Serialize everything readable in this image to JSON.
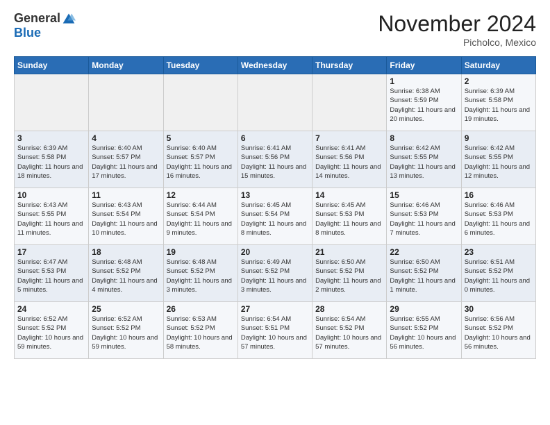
{
  "header": {
    "logo_general": "General",
    "logo_blue": "Blue",
    "month_title": "November 2024",
    "location": "Picholco, Mexico"
  },
  "weekdays": [
    "Sunday",
    "Monday",
    "Tuesday",
    "Wednesday",
    "Thursday",
    "Friday",
    "Saturday"
  ],
  "weeks": [
    [
      {
        "day": "",
        "info": ""
      },
      {
        "day": "",
        "info": ""
      },
      {
        "day": "",
        "info": ""
      },
      {
        "day": "",
        "info": ""
      },
      {
        "day": "",
        "info": ""
      },
      {
        "day": "1",
        "info": "Sunrise: 6:38 AM\nSunset: 5:59 PM\nDaylight: 11 hours and 20 minutes."
      },
      {
        "day": "2",
        "info": "Sunrise: 6:39 AM\nSunset: 5:58 PM\nDaylight: 11 hours and 19 minutes."
      }
    ],
    [
      {
        "day": "3",
        "info": "Sunrise: 6:39 AM\nSunset: 5:58 PM\nDaylight: 11 hours and 18 minutes."
      },
      {
        "day": "4",
        "info": "Sunrise: 6:40 AM\nSunset: 5:57 PM\nDaylight: 11 hours and 17 minutes."
      },
      {
        "day": "5",
        "info": "Sunrise: 6:40 AM\nSunset: 5:57 PM\nDaylight: 11 hours and 16 minutes."
      },
      {
        "day": "6",
        "info": "Sunrise: 6:41 AM\nSunset: 5:56 PM\nDaylight: 11 hours and 15 minutes."
      },
      {
        "day": "7",
        "info": "Sunrise: 6:41 AM\nSunset: 5:56 PM\nDaylight: 11 hours and 14 minutes."
      },
      {
        "day": "8",
        "info": "Sunrise: 6:42 AM\nSunset: 5:55 PM\nDaylight: 11 hours and 13 minutes."
      },
      {
        "day": "9",
        "info": "Sunrise: 6:42 AM\nSunset: 5:55 PM\nDaylight: 11 hours and 12 minutes."
      }
    ],
    [
      {
        "day": "10",
        "info": "Sunrise: 6:43 AM\nSunset: 5:55 PM\nDaylight: 11 hours and 11 minutes."
      },
      {
        "day": "11",
        "info": "Sunrise: 6:43 AM\nSunset: 5:54 PM\nDaylight: 11 hours and 10 minutes."
      },
      {
        "day": "12",
        "info": "Sunrise: 6:44 AM\nSunset: 5:54 PM\nDaylight: 11 hours and 9 minutes."
      },
      {
        "day": "13",
        "info": "Sunrise: 6:45 AM\nSunset: 5:54 PM\nDaylight: 11 hours and 8 minutes."
      },
      {
        "day": "14",
        "info": "Sunrise: 6:45 AM\nSunset: 5:53 PM\nDaylight: 11 hours and 8 minutes."
      },
      {
        "day": "15",
        "info": "Sunrise: 6:46 AM\nSunset: 5:53 PM\nDaylight: 11 hours and 7 minutes."
      },
      {
        "day": "16",
        "info": "Sunrise: 6:46 AM\nSunset: 5:53 PM\nDaylight: 11 hours and 6 minutes."
      }
    ],
    [
      {
        "day": "17",
        "info": "Sunrise: 6:47 AM\nSunset: 5:53 PM\nDaylight: 11 hours and 5 minutes."
      },
      {
        "day": "18",
        "info": "Sunrise: 6:48 AM\nSunset: 5:52 PM\nDaylight: 11 hours and 4 minutes."
      },
      {
        "day": "19",
        "info": "Sunrise: 6:48 AM\nSunset: 5:52 PM\nDaylight: 11 hours and 3 minutes."
      },
      {
        "day": "20",
        "info": "Sunrise: 6:49 AM\nSunset: 5:52 PM\nDaylight: 11 hours and 3 minutes."
      },
      {
        "day": "21",
        "info": "Sunrise: 6:50 AM\nSunset: 5:52 PM\nDaylight: 11 hours and 2 minutes."
      },
      {
        "day": "22",
        "info": "Sunrise: 6:50 AM\nSunset: 5:52 PM\nDaylight: 11 hours and 1 minute."
      },
      {
        "day": "23",
        "info": "Sunrise: 6:51 AM\nSunset: 5:52 PM\nDaylight: 11 hours and 0 minutes."
      }
    ],
    [
      {
        "day": "24",
        "info": "Sunrise: 6:52 AM\nSunset: 5:52 PM\nDaylight: 10 hours and 59 minutes."
      },
      {
        "day": "25",
        "info": "Sunrise: 6:52 AM\nSunset: 5:52 PM\nDaylight: 10 hours and 59 minutes."
      },
      {
        "day": "26",
        "info": "Sunrise: 6:53 AM\nSunset: 5:52 PM\nDaylight: 10 hours and 58 minutes."
      },
      {
        "day": "27",
        "info": "Sunrise: 6:54 AM\nSunset: 5:51 PM\nDaylight: 10 hours and 57 minutes."
      },
      {
        "day": "28",
        "info": "Sunrise: 6:54 AM\nSunset: 5:52 PM\nDaylight: 10 hours and 57 minutes."
      },
      {
        "day": "29",
        "info": "Sunrise: 6:55 AM\nSunset: 5:52 PM\nDaylight: 10 hours and 56 minutes."
      },
      {
        "day": "30",
        "info": "Sunrise: 6:56 AM\nSunset: 5:52 PM\nDaylight: 10 hours and 56 minutes."
      }
    ]
  ]
}
